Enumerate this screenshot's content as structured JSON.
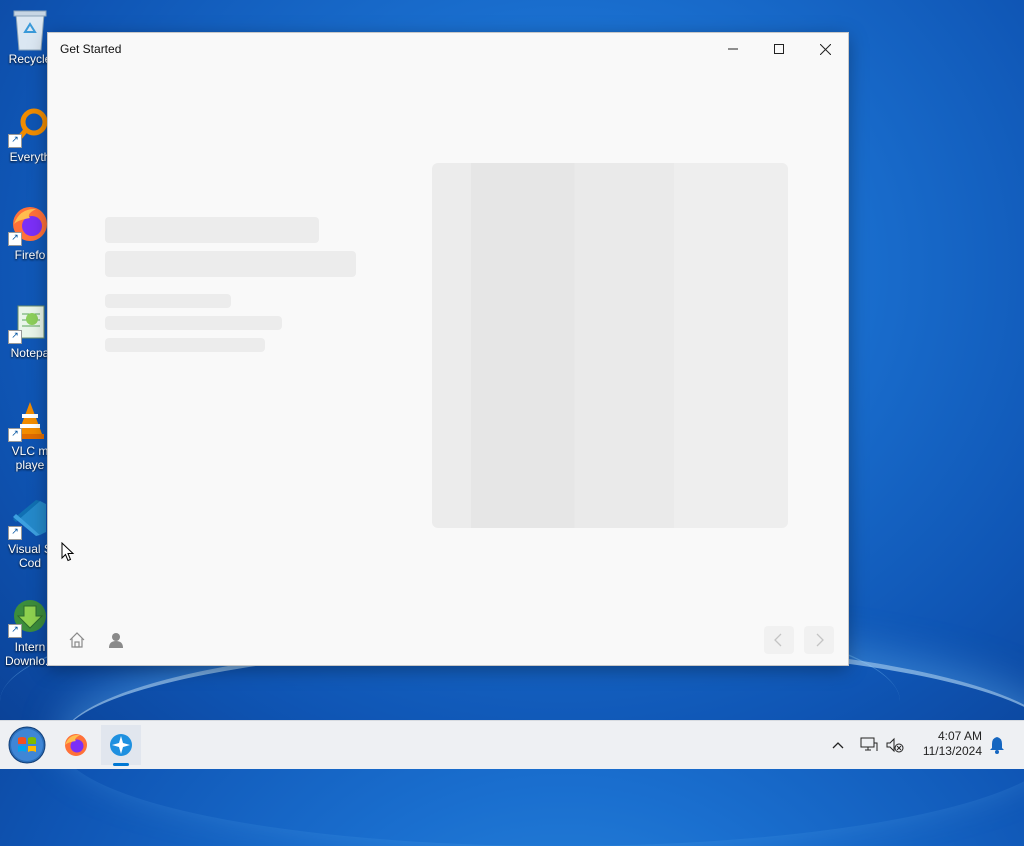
{
  "desktop": {
    "icons": [
      {
        "label": "Recycle",
        "name": "recycle-bin-icon"
      },
      {
        "label": "Everyth",
        "name": "everything-icon"
      },
      {
        "label": "Firefo",
        "name": "firefox-icon"
      },
      {
        "label": "Notepa",
        "name": "notepad-icon"
      },
      {
        "label": "VLC m",
        "label2": "playe",
        "name": "vlc-icon"
      },
      {
        "label": "Visual S",
        "label2": "Cod",
        "name": "vscode-icon"
      },
      {
        "label": "Intern",
        "label2": "Downlo...",
        "name": "internet-download-manager-icon"
      }
    ]
  },
  "window": {
    "title": "Get Started",
    "controls": {
      "minimize": "minimize-icon",
      "maximize": "maximize-icon",
      "close": "close-icon"
    }
  },
  "bottom_nav": {
    "left": [
      "home-icon",
      "person-icon"
    ],
    "right": [
      "chevron-left-icon",
      "chevron-right-icon"
    ]
  },
  "taskbar": {
    "items": [
      "start-button",
      "firefox-icon",
      "get-started-icon"
    ],
    "clock": {
      "time": "4:07 AM",
      "date": "11/13/2024"
    },
    "tray": [
      "chevron-up-icon",
      "network-icon",
      "volume-muted-icon",
      "notification-bell-icon"
    ]
  },
  "colors": {
    "accent": "#0078d4",
    "window_bg": "#f9f9f9",
    "skeleton": "#ececec"
  }
}
